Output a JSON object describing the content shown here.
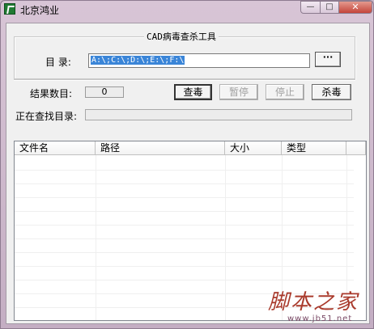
{
  "window": {
    "title": "北京鸿业",
    "controls": {
      "minimize": "—",
      "maximize": "□",
      "close": "✕"
    }
  },
  "group": {
    "title": "CAD病毒查杀工具"
  },
  "directory": {
    "label": "目 录:",
    "value": "A:\\;C:\\;D:\\;E:\\;F:\\",
    "browse_label": "···"
  },
  "results": {
    "label": "结果数目:",
    "count": "0"
  },
  "buttons": {
    "scan": "查毒",
    "pause": "暂停",
    "stop": "停止",
    "kill": "杀毒"
  },
  "current_dir": {
    "label": "正在查找目录:"
  },
  "table": {
    "columns": [
      "文件名",
      "路径",
      "大小",
      "类型"
    ],
    "rows": []
  },
  "watermark": {
    "text": "脚本之家",
    "url": "www.jb51.net"
  },
  "colors": {
    "selection": "#3a85d8",
    "watermark": "#a93a2c",
    "frame": "#c9b6c8"
  },
  "icons": {
    "app": "hongye-logo-icon"
  }
}
